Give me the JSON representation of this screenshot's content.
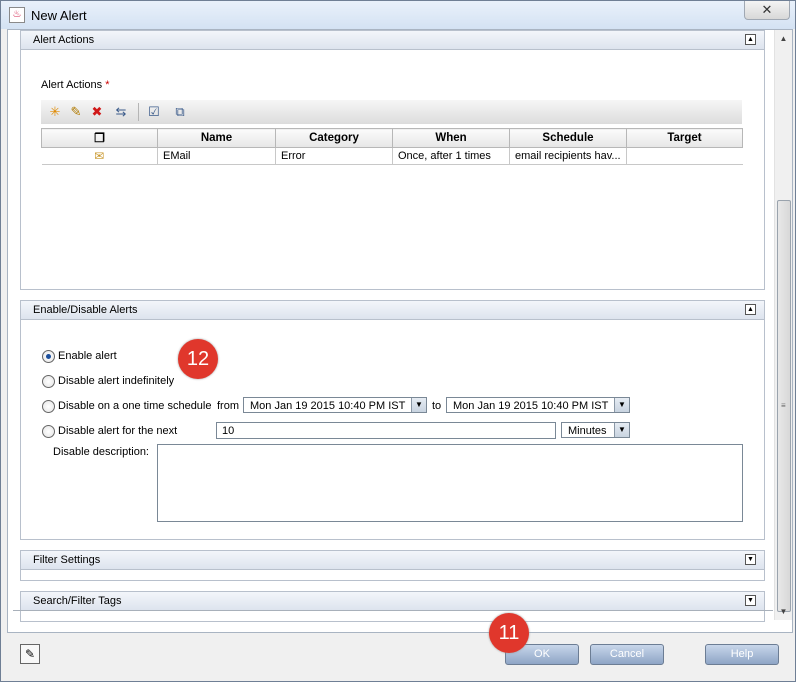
{
  "window": {
    "title": "New Alert",
    "close_glyph": "✕"
  },
  "alert_actions": {
    "section_title": "Alert Actions",
    "field_label": "Alert Actions",
    "required_mark": "*",
    "toolbar": [
      {
        "name": "new-action-button",
        "icon": "asterisk-icon",
        "glyph": "✳",
        "color": "#e08a00"
      },
      {
        "name": "edit-action-button",
        "icon": "pencil-icon",
        "glyph": "✎",
        "color": "#b07a00"
      },
      {
        "name": "delete-action-button",
        "icon": "delete-x-icon",
        "glyph": "✖",
        "color": "#d01818"
      },
      {
        "name": "copy-action-button",
        "icon": "copy-icon",
        "glyph": "⇆",
        "color": "#3a5a8a"
      },
      {
        "name": "select-actions-button",
        "icon": "checklist-icon",
        "glyph": "☑",
        "color": "#3a5a8a"
      },
      {
        "name": "clone-action-button",
        "icon": "clone-icon",
        "glyph": "⧉",
        "color": "#3a5a8a"
      }
    ],
    "columns": [
      "",
      "Name",
      "Category",
      "When",
      "Schedule",
      "Target"
    ],
    "rows": [
      {
        "icon": "email-icon",
        "name": "EMail",
        "category": "Error",
        "when": "Once, after 1 times",
        "schedule": "email recipients hav...",
        "target": ""
      }
    ]
  },
  "enable_disable": {
    "section_title": "Enable/Disable Alerts",
    "options": {
      "enable": "Enable alert",
      "disable_indefinitely": "Disable alert indefinitely",
      "disable_schedule": "Disable on a one time schedule",
      "disable_next": "Disable alert for the next"
    },
    "selected": "enable",
    "from_label": "from",
    "to_label": "to",
    "from_value": "Mon Jan 19 2015 10:40 PM IST",
    "to_value": "Mon Jan 19 2015 10:40 PM IST",
    "duration_value": "10",
    "duration_unit": "Minutes",
    "description_label": "Disable description:",
    "description_value": ""
  },
  "filter_settings": {
    "section_title": "Filter Settings"
  },
  "search_filter_tags": {
    "section_title": "Search/Filter Tags"
  },
  "annotations": {
    "step_12": "12",
    "step_11": "11",
    "color": "#e0372c"
  },
  "buttons": {
    "ok": "OK",
    "cancel": "Cancel",
    "help": "Help"
  }
}
